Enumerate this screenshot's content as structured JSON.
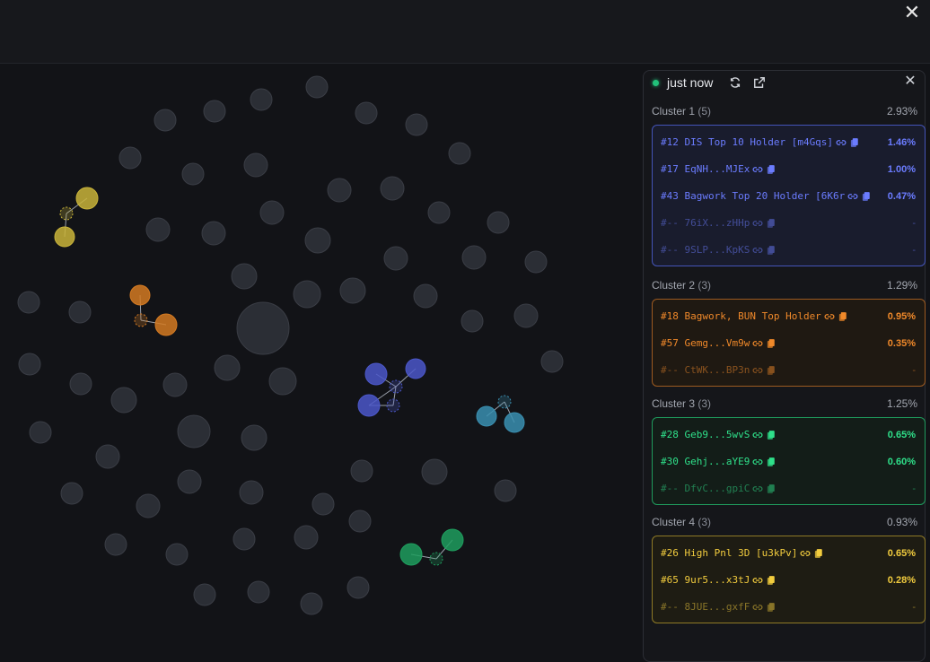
{
  "window": {
    "close_glyph": "✕"
  },
  "panel": {
    "updated_label": "just now",
    "close_glyph": "✕",
    "clusters": [
      {
        "name": "Cluster 1",
        "count": "(5)",
        "pct": "2.93%",
        "color": "#6b7cff",
        "bg": "#191c2d",
        "border": "#4454b8",
        "rows": [
          {
            "label": "#12 DIS Top 10 Holder [m4Gqs]",
            "pct": "1.46%",
            "faded": false
          },
          {
            "label": "#17 EqNH...MJEx",
            "pct": "1.00%",
            "faded": false
          },
          {
            "label": "#43 Bagwork Top 20 Holder [6K6r",
            "pct": "0.47%",
            "faded": false
          },
          {
            "label": "#-- 76iX...zHHp",
            "pct": "-",
            "faded": true
          },
          {
            "label": "#-- 9SLP...KpKS",
            "pct": "-",
            "faded": true
          }
        ]
      },
      {
        "name": "Cluster 2",
        "count": "(3)",
        "pct": "1.29%",
        "color": "#f0892a",
        "bg": "#1f1912",
        "border": "#9c5a20",
        "rows": [
          {
            "label": "#18 Bagwork, BUN Top Holder",
            "pct": "0.95%",
            "faded": false
          },
          {
            "label": "#57 Gemg...Vm9w",
            "pct": "0.35%",
            "faded": false
          },
          {
            "label": "#-- CtWK...BP3n",
            "pct": "-",
            "faded": true
          }
        ]
      },
      {
        "name": "Cluster 3",
        "count": "(3)",
        "pct": "1.25%",
        "color": "#2fe08a",
        "bg": "#131d18",
        "border": "#1f9a5d",
        "rows": [
          {
            "label": "#28 Geb9...5wvS",
            "pct": "0.65%",
            "faded": false
          },
          {
            "label": "#30 Gehj...aYE9",
            "pct": "0.60%",
            "faded": false
          },
          {
            "label": "#-- DfvC...gpiC",
            "pct": "-",
            "faded": true
          }
        ]
      },
      {
        "name": "Cluster 4",
        "count": "(3)",
        "pct": "0.93%",
        "color": "#f2cc3e",
        "bg": "#1e1c13",
        "border": "#8f7a26",
        "rows": [
          {
            "label": "#26 High Pnl 3D [u3kPv]",
            "pct": "0.65%",
            "faded": false
          },
          {
            "label": "#65 9ur5...x3tJ",
            "pct": "0.28%",
            "faded": false
          },
          {
            "label": "#-- 8JUE...gxfF",
            "pct": "-",
            "faded": true
          }
        ]
      }
    ]
  },
  "graph": {
    "node_color": "#2b2e35",
    "node_stroke": "#3a3d45",
    "clusters": [
      {
        "color": "#c9b43a"
      },
      {
        "color": "#d47a22"
      },
      {
        "color": "#4b57c9"
      },
      {
        "color": "#3a8fb0"
      },
      {
        "color": "#1f9e5e"
      }
    ]
  }
}
